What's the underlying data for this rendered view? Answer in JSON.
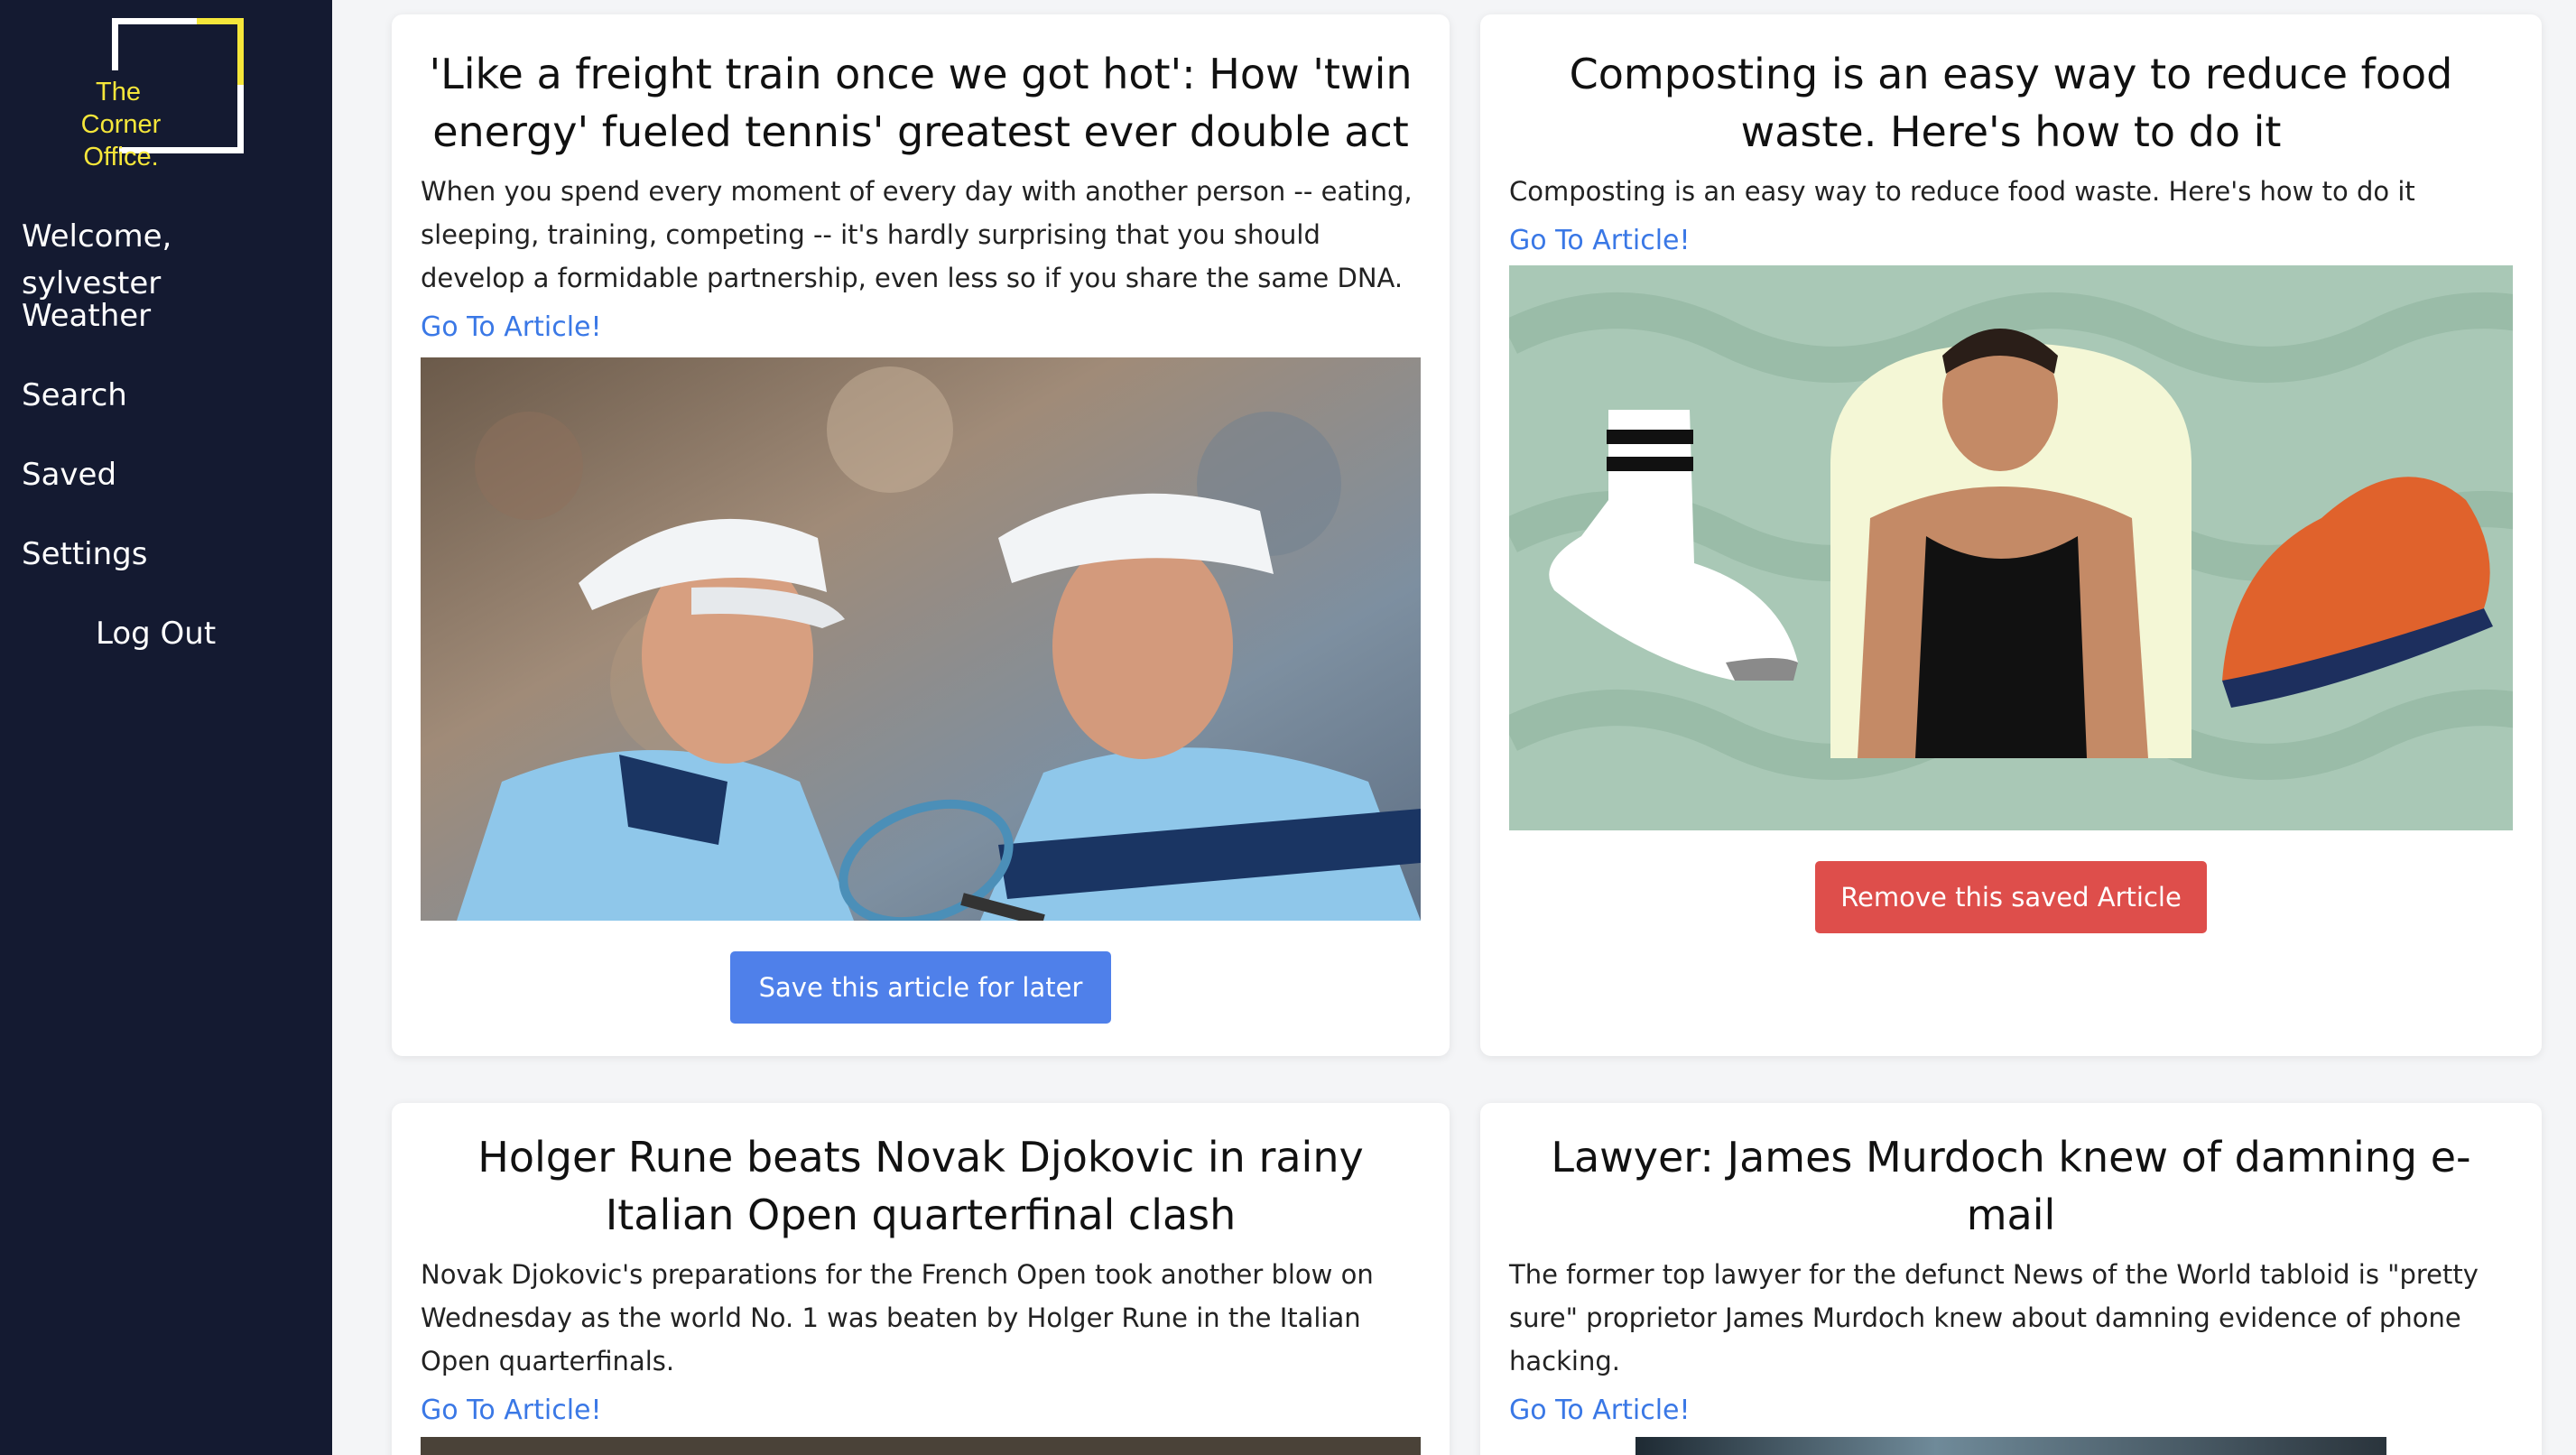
{
  "app": {
    "logo_text_line1": "The",
    "logo_text_line2": "Corner",
    "logo_text_line3": "Office."
  },
  "sidebar": {
    "items": [
      {
        "label": "Welcome, sylvester"
      },
      {
        "label": "Weather"
      },
      {
        "label": "Search"
      },
      {
        "label": "Saved"
      },
      {
        "label": "Settings"
      },
      {
        "label": "Log Out"
      }
    ]
  },
  "articles": [
    {
      "title": "'Like a freight train once we got hot': How 'twin energy' fueled tennis' greatest ever double act",
      "description": "When you spend every moment of every day with another person -- eating, sleeping, training, competing -- it's hardly surprising that you should develop a formidable partnership, even less so if you share the same DNA.",
      "link_label": "Go To Article!",
      "image_caption": "tennis twins photo",
      "button_label": "Save this article for later"
    },
    {
      "title": "Composting is an easy way to reduce food waste. Here's how to do it",
      "description": "Composting is an easy way to reduce food waste. Here's how to do it",
      "link_label": "Go To Article!",
      "image_caption": "sock, man and sneaker product photo",
      "button_label": "Remove this saved Article"
    },
    {
      "title": "Holger Rune beats Novak Djokovic in rainy Italian Open quarterfinal clash",
      "description": "Novak Djokovic's preparations for the French Open took another blow on Wednesday as the world No. 1 was beaten by Holger Rune in the Italian Open quarterfinals.",
      "link_label": "Go To Article!"
    },
    {
      "title": "Lawyer: James Murdoch knew of damning e-mail",
      "description": "The former top lawyer for the defunct News of the World tabloid is \"pretty sure\" proprietor James Murdoch knew about damning evidence of phone hacking.",
      "link_label": "Go To Article!"
    }
  ],
  "colors": {
    "sidebar_bg": "#141a31",
    "accent_yellow": "#f5e63a",
    "link_blue": "#3a78e6",
    "save_button": "#4f80ea",
    "remove_button": "#de4e4b"
  }
}
